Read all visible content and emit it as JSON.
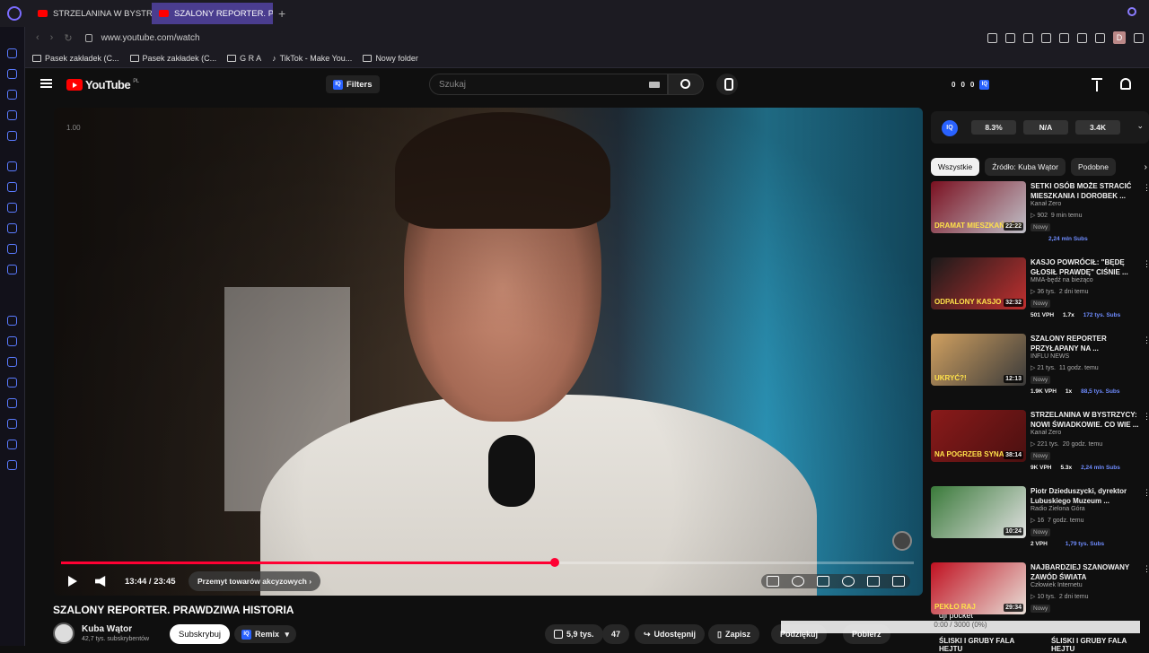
{
  "browser": {
    "tabs": [
      {
        "label": "STRZELANINA W BYSTRZ"
      },
      {
        "label": "SZALONY REPORTER. PRA"
      }
    ],
    "url": "www.youtube.com/watch",
    "profile_initial": "D",
    "bookmarks": [
      {
        "label": "Pasek zakładek (C..."
      },
      {
        "label": "Pasek zakładek (C..."
      },
      {
        "label": "G R A"
      },
      {
        "label": "TikTok - Make You..."
      },
      {
        "label": "Nowy folder"
      }
    ]
  },
  "header": {
    "logo_text": "YouTube",
    "logo_region": "PL",
    "filters_label": "Filters",
    "search_placeholder": "Szukaj",
    "stats": [
      "0",
      "0",
      "0"
    ],
    "iq_label": "IQ"
  },
  "player": {
    "overlay_label": "1.00",
    "time": "13:44 / 23:45",
    "chapter": "Przemyt towarów akcyzowych",
    "progress": 0.579
  },
  "video": {
    "title": "SZALONY REPORTER. PRAWDZIWA HISTORIA",
    "channel": "Kuba Wątor",
    "subscribers": "42,7 tys. subskrybentów",
    "subscribe_label": "Subskrybuj",
    "remix_label": "Remix",
    "likes": "5,9 tys.",
    "comments": "47",
    "share_label": "Udostępnij",
    "save_label": "Zapisz",
    "thanks_label": "Podziękuj",
    "download_label": "Pobierz"
  },
  "overlay": {
    "camera_name": "dji pocket",
    "recording": "0:00 / 3000 (0%)"
  },
  "panel": {
    "stats": [
      "8.3%",
      "N/A",
      "3.4K"
    ],
    "chips": [
      "Wszystkie",
      "Źródło: Kuba Wątor",
      "Podobne"
    ],
    "recommendations": [
      {
        "title": "SETKI OSÓB MOŻE STRACIĆ MIESZKANIA I DOROBEK ...",
        "channel": "Kanał Zero",
        "views": "902",
        "age": "9 min temu",
        "badge": "Nowy",
        "stat1": "",
        "stat2": "",
        "stat3": "2,24 mln Subs",
        "duration": "22:22",
        "thumb_text": "DRAMAT MIESZKAŃCÓW",
        "colors": [
          "#7a1020",
          "#c0c0c8"
        ]
      },
      {
        "title": "KASJO POWRÓCIŁ: \"BĘDĘ GŁOSIŁ PRAWDĘ\" CIŚNIE ...",
        "channel": "MMA-będź na bieżąco",
        "views": "36 tys.",
        "age": "2 dni temu",
        "badge": "Nowy",
        "stat1": "501 VPH",
        "stat2": "1.7x",
        "stat3": "172 tys. Subs",
        "duration": "32:32",
        "thumb_text": "ODPALONY KASJO",
        "colors": [
          "#1a1a1a",
          "#c03030"
        ]
      },
      {
        "title": "SZALONY REPORTER PRZYŁAPANY NA ...",
        "channel": "INFLU NEWS",
        "views": "21 tys.",
        "age": "11 godz. temu",
        "badge": "Nowy",
        "stat1": "1.9K VPH",
        "stat2": "1x",
        "stat3": "88,5 tys. Subs",
        "duration": "12:13",
        "thumb_text": "UKRYĆ?!",
        "colors": [
          "#d0a060",
          "#3a3a3a"
        ]
      },
      {
        "title": "STRZELANINA W BYSTRZYCY: NOWI ŚWIADKOWIE. CO WIE ...",
        "channel": "Kanał Zero",
        "views": "221 tys.",
        "age": "20 godz. temu",
        "badge": "Nowy",
        "stat1": "9K VPH",
        "stat2": "5.3x",
        "stat3": "2,24 mln Subs",
        "duration": "38:14",
        "thumb_text": "NA POGRZEB SYNA",
        "colors": [
          "#8a1a1a",
          "#4a1010"
        ]
      },
      {
        "title": "Piotr Dzieduszycki, dyrektor Lubuskiego Muzeum ...",
        "channel": "Radio Zielona Góra",
        "views": "16",
        "age": "7 godz. temu",
        "badge": "Nowy",
        "stat1": "2 VPH",
        "stat2": "",
        "stat3": "1,79 tys. Subs",
        "duration": "10:24",
        "thumb_text": "",
        "colors": [
          "#3a7a3a",
          "#e0e0e0"
        ]
      },
      {
        "title": "NAJBARDZIEJ SZANOWANY ZAWÓD ŚWIATA",
        "channel": "Człowiek Internetu",
        "views": "10 tys.",
        "age": "2 dni temu",
        "badge": "Nowy",
        "stat1": "",
        "stat2": "",
        "stat3": "",
        "duration": "29:34",
        "thumb_text": "PEKŁO RAJ",
        "colors": [
          "#c01020",
          "#e8e0d8"
        ]
      }
    ],
    "bottom_labels": [
      "ŚLISKI I GRUBY FALA HEJTU",
      "ŚLISKI I GRUBY FALA HEJTU"
    ]
  },
  "colors": {
    "accent": "#ff0033",
    "brand": "#ff0000",
    "iq": "#2962ff"
  }
}
